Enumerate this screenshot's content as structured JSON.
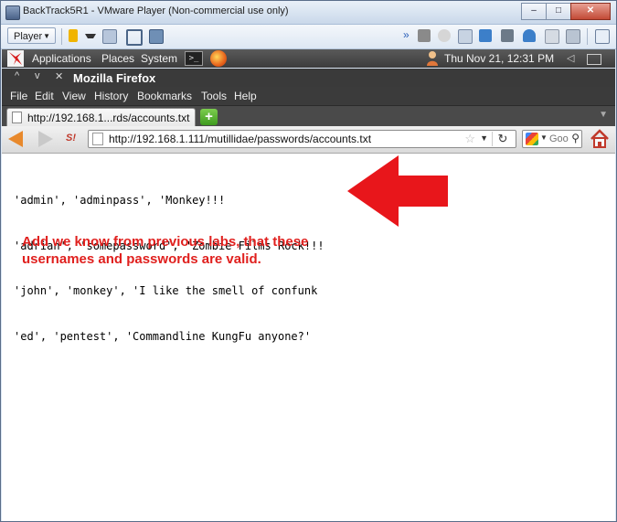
{
  "vm_window": {
    "title": "BackTrack5R1 - VMware Player (Non-commercial use only)",
    "controls": [
      "–",
      "□",
      "✕"
    ]
  },
  "vm_toolbar": {
    "player_label": "Player"
  },
  "gnome_panel": {
    "menus": [
      "Applications",
      "Places",
      "System"
    ],
    "clock": "Thu Nov 21, 12:31 PM"
  },
  "firefox": {
    "window_title": "Mozilla Firefox",
    "menu": [
      "File",
      "Edit",
      "View",
      "History",
      "Bookmarks",
      "Tools",
      "Help"
    ],
    "tab_label": "http://192.168.1...rds/accounts.txt",
    "url": "http://192.168.1.111/mutillidae/passwords/accounts.txt",
    "search_placeholder": "Goo"
  },
  "page": {
    "lines": [
      "'admin', 'adminpass', 'Monkey!!!",
      "'adrian', 'somepassword', 'Zombie Films Rock!!!",
      "'john', 'monkey', 'I like the smell of confunk",
      "'ed', 'pentest', 'Commandline KungFu anyone?'"
    ],
    "annotation": "Add we know from previous labs, that these usernames and passwords are valid."
  },
  "colors": {
    "annotation": "#e0201e",
    "arrow": "#e8161b"
  }
}
